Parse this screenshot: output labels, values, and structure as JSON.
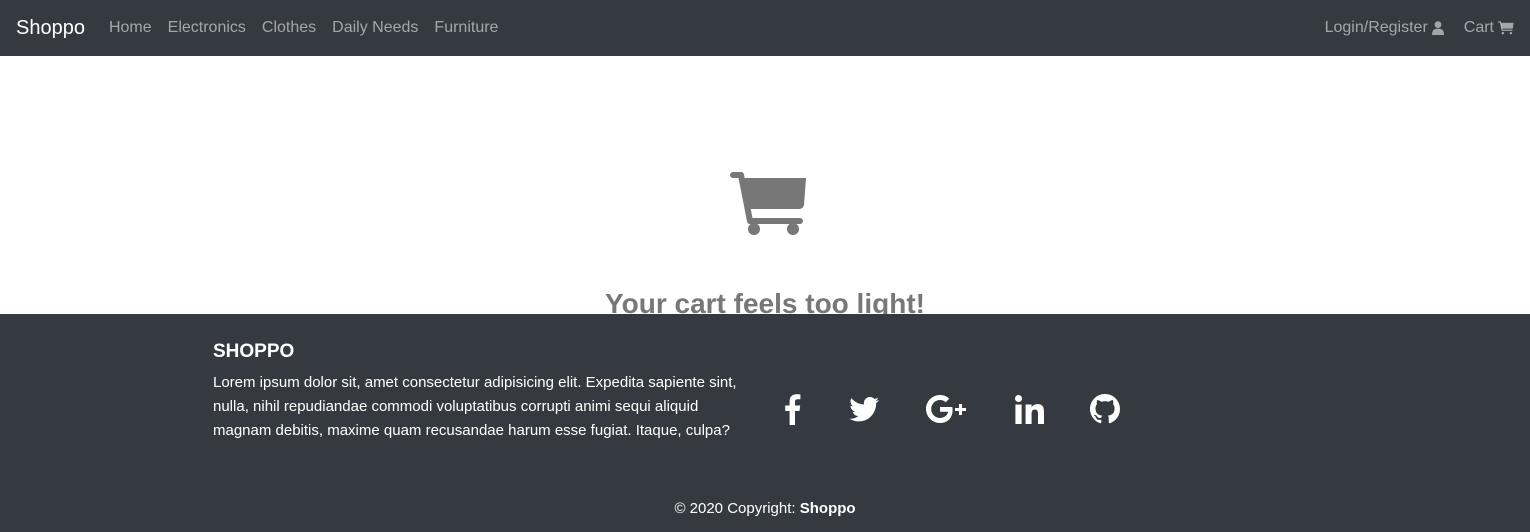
{
  "navbar": {
    "brand": "Shoppo",
    "links": [
      "Home",
      "Electronics",
      "Clothes",
      "Daily Needs",
      "Furniture"
    ],
    "login_label": "Login/Register",
    "login_icon": "user-icon",
    "cart_label": "Cart",
    "cart_icon": "cart-icon"
  },
  "main": {
    "empty_icon": "cart-icon",
    "empty_message": "Your cart feels too light!"
  },
  "footer": {
    "title": "SHOPPO",
    "description": "Lorem ipsum dolor sit, amet consectetur adipisicing elit. Expedita sapiente sint, nulla, nihil repudiandae commodi voluptatibus corrupti animi sequi aliquid magnam debitis, maxime quam recusandae harum esse fugiat. Itaque, culpa?",
    "social_icons": [
      "facebook-icon",
      "twitter-icon",
      "google-plus-icon",
      "linkedin-icon",
      "github-icon"
    ],
    "copyright_prefix": "© 2020 Copyright:",
    "copyright_brand": "Shoppo"
  },
  "colors": {
    "nav_bg": "#343a40",
    "footer_bg": "#343a40",
    "muted_text": "#777777"
  }
}
